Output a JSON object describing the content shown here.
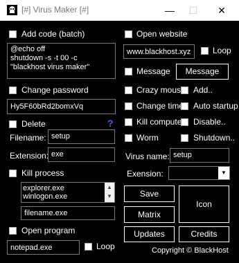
{
  "window": {
    "title": "[#] Virus Maker [#]",
    "minimize": "—",
    "maximize": "☐",
    "close": "✕"
  },
  "left": {
    "add_code": {
      "label": "Add code (batch)",
      "code": "@echo off\nshutdown -s -t 00 -c \"blackhost virus maker\""
    },
    "change_password": {
      "label": "Change password",
      "value": "Hy5F60bRd2bomxVq"
    },
    "delete": {
      "label": "Delete",
      "help": "?",
      "filename_label": "Filename:",
      "filename": "setup",
      "extension_label": "Extension:",
      "extension": "exe"
    },
    "kill_process": {
      "label": "Kill process",
      "processes": [
        "explorer.exe",
        "winlogon.exe"
      ],
      "filename": "filename.exe"
    },
    "open_program": {
      "label": "Open program",
      "program": "notepad.exe",
      "loop_label": "Loop"
    }
  },
  "right": {
    "open_website": {
      "label": "Open website",
      "url": "www.blackhost.xyz",
      "loop_label": "Loop"
    },
    "message": {
      "label": "Message",
      "button": "Message"
    },
    "options": {
      "crazy_mouse": "Crazy mouse",
      "add": "Add..",
      "change_time": "Change time",
      "auto_startup": "Auto startup..",
      "kill_computer": "Kill computer",
      "disable": "Disable..",
      "worm": "Worm",
      "shutdown": "Shutdown.."
    },
    "virus_name_label": "Virus name:",
    "virus_name": "setup",
    "extension_label": "Exension:",
    "extension_value": ""
  },
  "buttons": {
    "save": "Save",
    "matrix": "Matrix",
    "icon": "Icon",
    "updates": "Updates",
    "credits": "Credits"
  },
  "footer": {
    "copyright": "Copyright © BlackHost"
  }
}
